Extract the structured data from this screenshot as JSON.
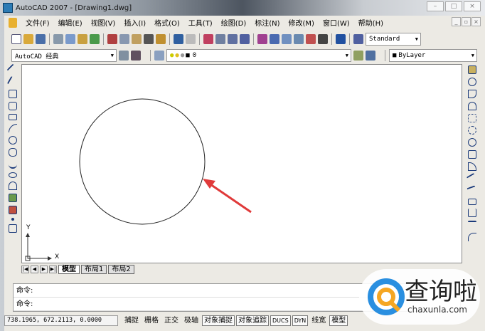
{
  "window": {
    "title": "AutoCAD 2007 - [Drawing1.dwg]"
  },
  "menu": [
    "文件(F)",
    "编辑(E)",
    "视图(V)",
    "插入(I)",
    "格式(O)",
    "工具(T)",
    "绘图(D)",
    "标注(N)",
    "修改(M)",
    "窗口(W)",
    "帮助(H)"
  ],
  "toolbar": {
    "text_style": "Standard",
    "workspace": "AutoCAD 经典",
    "layer": "0",
    "color": "ByLayer"
  },
  "canvas": {
    "ucs_y": "Y",
    "ucs_x": "X"
  },
  "tabs": [
    "模型",
    "布局1",
    "布局2"
  ],
  "command": {
    "line1": "命令:",
    "line2": "命令:"
  },
  "status": {
    "coords": "738.1965, 672.2113, 0.0000",
    "toggles": [
      {
        "label": "捕捉",
        "on": false
      },
      {
        "label": "栅格",
        "on": false
      },
      {
        "label": "正交",
        "on": false
      },
      {
        "label": "极轴",
        "on": false
      },
      {
        "label": "对象捕捉",
        "on": true
      },
      {
        "label": "对象追踪",
        "on": true
      },
      {
        "label": "DUCS",
        "on": true
      },
      {
        "label": "DYN",
        "on": true
      },
      {
        "label": "线宽",
        "on": false
      },
      {
        "label": "模型",
        "on": true
      }
    ]
  },
  "watermark": {
    "name": "查询啦",
    "url": "chaxunla.com"
  },
  "colors": {
    "arrow": "#e03a3a",
    "accent": "#1b3a7a"
  }
}
